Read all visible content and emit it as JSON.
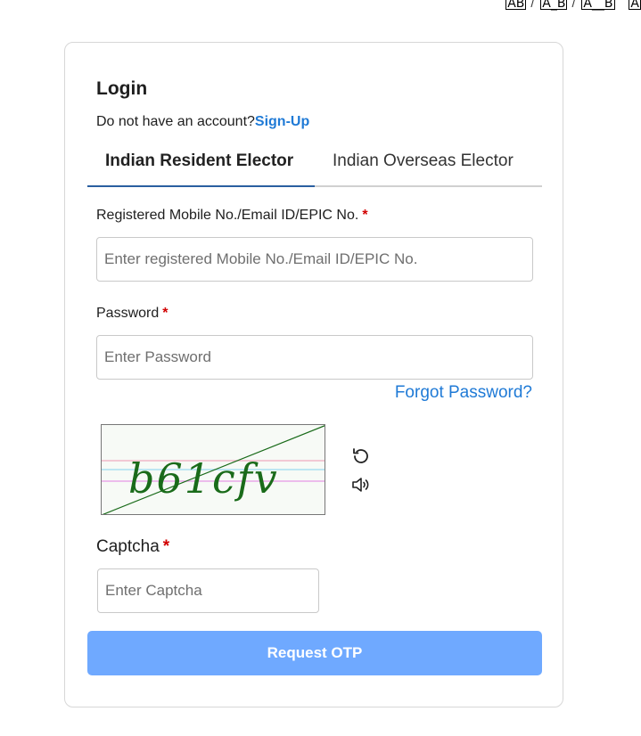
{
  "font_size_options": [
    "AB",
    "A_B",
    "A__B",
    "A"
  ],
  "login": {
    "title": "Login",
    "no_account_text": "Do not have an account?",
    "signup_label": "Sign-Up"
  },
  "tabs": [
    {
      "label": "Indian Resident Elector",
      "active": true
    },
    {
      "label": "Indian Overseas Elector",
      "active": false
    }
  ],
  "form": {
    "id_label": "Registered Mobile No./Email ID/EPIC No.",
    "id_placeholder": "Enter registered Mobile No./Email ID/EPIC No.",
    "password_label": "Password",
    "password_placeholder": "Enter Password",
    "required_mark": "*",
    "forgot_password": "Forgot Password?",
    "captcha_image_text": "b61cfv",
    "captcha_label": "Captcha",
    "captcha_placeholder": "Enter Captcha",
    "submit_label": "Request OTP"
  },
  "colors": {
    "link": "#1f7ad6",
    "button": "#6fa9ff",
    "required": "#d10000",
    "tab_underline": "#2a5fa0"
  },
  "icons": {
    "refresh": "refresh-icon",
    "audio": "speaker-icon"
  }
}
